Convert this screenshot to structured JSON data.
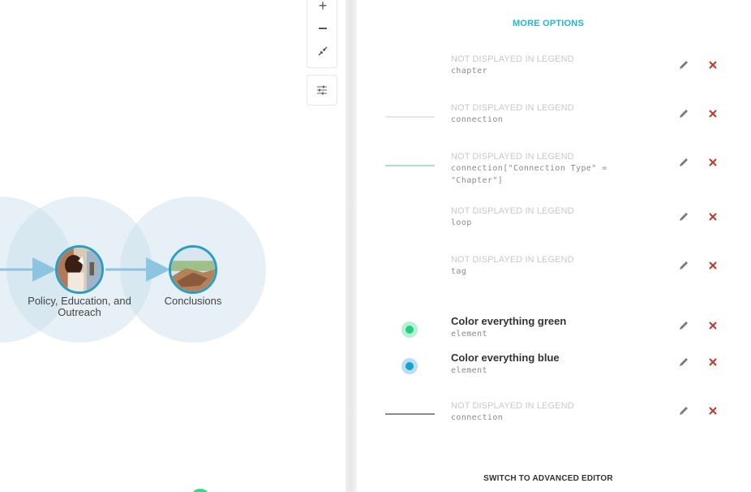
{
  "canvas": {
    "nodes": [
      {
        "id": "policy",
        "label": "Policy, Education, and Outreach"
      },
      {
        "id": "conclusions",
        "label": "Conclusions"
      }
    ],
    "zoom": {
      "zoom_in_icon": "plus-icon",
      "zoom_out_icon": "minus-icon",
      "fit_icon": "compress-icon",
      "filter_icon": "sliders-icon"
    }
  },
  "panel": {
    "more_options": "MORE OPTIONS",
    "switch_editor": "SWITCH TO ADVANCED EDITOR",
    "rows": [
      {
        "legend": "NOT DISPLAYED IN LEGEND",
        "selector": "chapter",
        "preview": "none"
      },
      {
        "legend": "NOT DISPLAYED IN LEGEND",
        "selector": "connection",
        "preview": "line",
        "color": "#e6e6e6"
      },
      {
        "legend": "NOT DISPLAYED IN LEGEND",
        "selector": "connection[\"Connection Type\" =\n\"Chapter\"]",
        "preview": "line",
        "color": "#a7e3c4"
      },
      {
        "legend": "NOT DISPLAYED IN LEGEND",
        "selector": "loop",
        "preview": "none"
      },
      {
        "legend": "NOT DISPLAYED IN LEGEND",
        "selector": "tag",
        "preview": "none"
      },
      {
        "label": "Color everything green",
        "selector": "element",
        "preview": "dot",
        "color": "#1fd17f",
        "halo": "#b8f0d3"
      },
      {
        "label": "Color everything blue",
        "selector": "element",
        "preview": "dot",
        "color": "#1a9fd1",
        "halo": "#b9dff0"
      },
      {
        "legend": "NOT DISPLAYED IN LEGEND",
        "selector": "connection",
        "preview": "line",
        "color": "#8c8c8c"
      }
    ],
    "edit_icon": "pencil-icon",
    "delete_icon": "close-icon",
    "delete_color": "#c0392b"
  }
}
